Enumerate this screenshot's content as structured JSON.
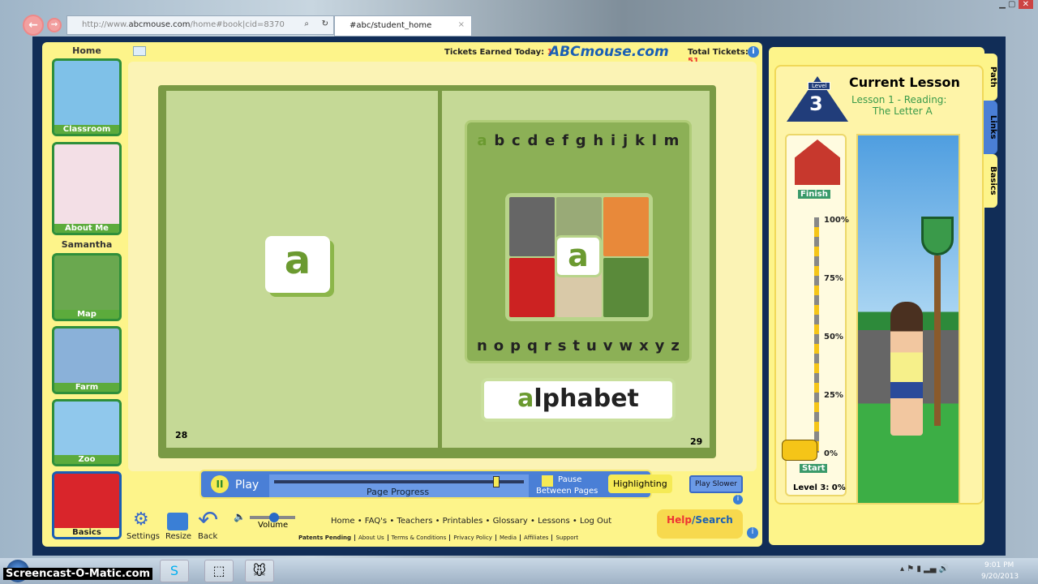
{
  "browser": {
    "url_domain": "abcmouse.com",
    "url_prefix": "http://www.",
    "url_path": "/home#book|cid=8370",
    "tab_title": "#abc/student_home",
    "tab_close": "×"
  },
  "header": {
    "tickets_today_label": "Tickets Earned Today:",
    "tickets_today": "1",
    "logo": "ABCmouse.com",
    "total_tickets_label": "Total Tickets:",
    "total_tickets": "51"
  },
  "sidebar": {
    "home_label": "Home",
    "user_name": "Samantha",
    "items": [
      {
        "label": "Classroom",
        "color": "#7fc1e8"
      },
      {
        "label": "About Me",
        "color": "#f3dfe6"
      },
      {
        "label": "Map",
        "color": "#6aa84f"
      },
      {
        "label": "Farm",
        "color": "#8ab1d9"
      },
      {
        "label": "Zoo",
        "color": "#90c8ec"
      },
      {
        "label": "Basics",
        "color": "#d9252b"
      }
    ]
  },
  "book": {
    "left_page_number": "28",
    "right_page_number": "29",
    "left_letter": "a",
    "row1": [
      "a",
      "b",
      "c",
      "d",
      "e",
      "f",
      "g",
      "h",
      "i",
      "j",
      "k",
      "l",
      "m"
    ],
    "row2": [
      "n",
      "o",
      "p",
      "q",
      "r",
      "s",
      "t",
      "u",
      "v",
      "w",
      "x",
      "y",
      "z"
    ],
    "center_letter": "a",
    "word_highlight": "a",
    "word_rest": "lphabet"
  },
  "controls": {
    "play_label": "Play",
    "progress_label": "Page Progress",
    "progress": 0.9,
    "pause_label_1": "Pause",
    "pause_label_2": "Between Pages",
    "highlighting_label": "Highlighting",
    "play_slower_label": "Play Slower"
  },
  "footer": {
    "settings": "Settings",
    "resize": "Resize",
    "back": "Back",
    "volume": "Volume",
    "links": [
      "Home",
      "FAQ's",
      "Teachers",
      "Printables",
      "Glossary",
      "Lessons",
      "Log Out"
    ],
    "patents": "Patents Pending",
    "small_links": [
      "About Us",
      "Terms & Conditions",
      "Privacy Policy",
      "Media",
      "Affiliates",
      "Support"
    ],
    "help": "Help",
    "search": "/Search"
  },
  "lesson": {
    "level_label": "Level",
    "level": "3",
    "title": "Current Lesson",
    "subtitle_1": "Lesson 1 - Reading:",
    "subtitle_2": "The Letter A",
    "finish": "Finish",
    "start": "Start",
    "ticks": [
      "100%",
      "75%",
      "50%",
      "25%",
      "0%"
    ],
    "progress_text": "Level 3: 0%",
    "progress": 0,
    "tabs": [
      "Path",
      "Links",
      "Basics"
    ]
  },
  "taskbar": {
    "watermark": "Screencast-O-Matic.com",
    "time": "9:01 PM",
    "date": "9/20/2013"
  }
}
